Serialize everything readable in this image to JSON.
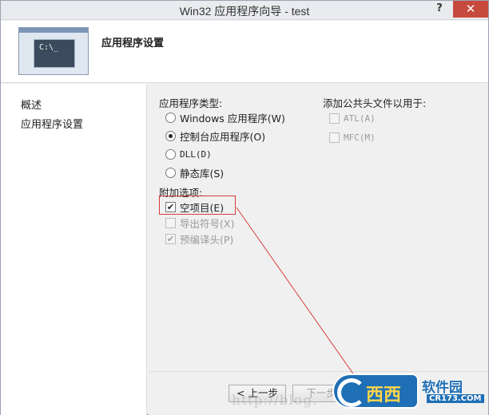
{
  "window": {
    "title": "Win32 应用程序向导 - test",
    "help": "?",
    "close": "✕"
  },
  "header": {
    "heading": "应用程序设置",
    "thumb_text": "C:\\_"
  },
  "nav": {
    "items": [
      {
        "label": "概述"
      },
      {
        "label": "应用程序设置"
      }
    ]
  },
  "app_type": {
    "label": "应用程序类型:",
    "options": [
      {
        "label": "Windows 应用程序(W)",
        "selected": false
      },
      {
        "label": "控制台应用程序(O)",
        "selected": true
      },
      {
        "label": "DLL(D)",
        "selected": false
      },
      {
        "label": "静态库(S)",
        "selected": false
      }
    ]
  },
  "extra": {
    "label": "附加选项:",
    "options": [
      {
        "label": "空项目(E)",
        "checked": true,
        "enabled": true
      },
      {
        "label": "导出符号(X)",
        "checked": false,
        "enabled": false
      },
      {
        "label": "预编译头(P)",
        "checked": true,
        "enabled": false
      }
    ]
  },
  "common_headers": {
    "label": "添加公共头文件以用于:",
    "options": [
      {
        "label": "ATL(A)",
        "checked": false,
        "enabled": false
      },
      {
        "label": "MFC(M)",
        "checked": false,
        "enabled": false
      }
    ]
  },
  "buttons": {
    "prev": "< 上一步",
    "next": "下一步"
  },
  "watermark": {
    "blog": "http://blog.",
    "brand": "西西",
    "site": "软件园",
    "url": "CR173.COM"
  },
  "colors": {
    "highlight": "#d93a3a",
    "close": "#c74a3e",
    "brand": "#1f6fb6"
  }
}
